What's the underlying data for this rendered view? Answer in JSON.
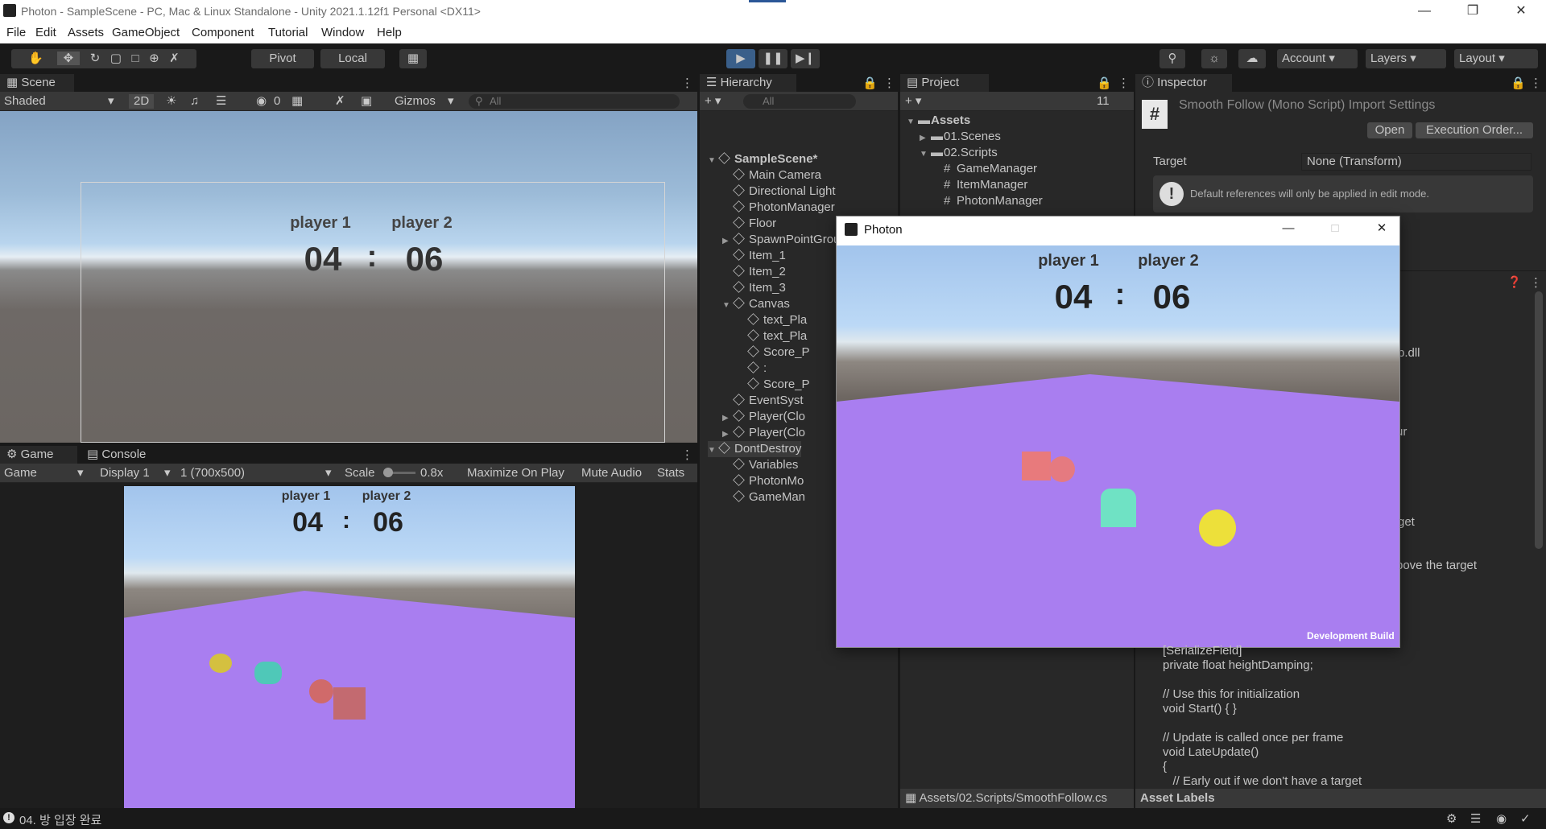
{
  "window": {
    "title": "Photon - SampleScene - PC, Mac & Linux Standalone - Unity 2021.1.12f1 Personal <DX11>"
  },
  "menu": [
    "File",
    "Edit",
    "Assets",
    "GameObject",
    "Component",
    "Tutorial",
    "Window",
    "Help"
  ],
  "toolbar": {
    "pivot": "Pivot",
    "local": "Local",
    "account": "Account",
    "layers": "Layers",
    "layout": "Layout"
  },
  "scene": {
    "tab": "Scene",
    "shading": "Shaded",
    "mode2d": "2D",
    "hidden_count": "0",
    "gizmos": "Gizmos",
    "search": "All"
  },
  "game": {
    "tab_game": "Game",
    "tab_console": "Console",
    "view": "Game",
    "display": "Display 1",
    "resolution": "1 (700x500)",
    "scale_label": "Scale",
    "scale_value": "0.8x",
    "maximize": "Maximize On Play",
    "mute": "Mute Audio",
    "stats": "Stats"
  },
  "score": {
    "p1": "player 1",
    "p2": "player 2",
    "s1": "04",
    "sep": ":",
    "s2": "06"
  },
  "hierarchy": {
    "tab": "Hierarchy",
    "search": "All",
    "items": [
      {
        "label": "SampleScene*"
      },
      {
        "label": "Main Camera"
      },
      {
        "label": "Directional Light"
      },
      {
        "label": "PhotonManager"
      },
      {
        "label": "Floor"
      },
      {
        "label": "SpawnPointGroup"
      },
      {
        "label": "Item_1"
      },
      {
        "label": "Item_2"
      },
      {
        "label": "Item_3"
      },
      {
        "label": "Canvas"
      },
      {
        "label": "text_Pla"
      },
      {
        "label": "text_Pla"
      },
      {
        "label": "Score_P"
      },
      {
        "label": ":"
      },
      {
        "label": "Score_P"
      },
      {
        "label": "EventSyst"
      },
      {
        "label": "Player(Clo"
      },
      {
        "label": "Player(Clo"
      },
      {
        "label": "DontDestroy"
      },
      {
        "label": "Variables"
      },
      {
        "label": "PhotonMo"
      },
      {
        "label": "GameMan"
      }
    ]
  },
  "project": {
    "tab": "Project",
    "hidden_count": "11",
    "items": [
      {
        "label": "Assets"
      },
      {
        "label": "01.Scenes"
      },
      {
        "label": "02.Scripts"
      },
      {
        "label": "GameManager"
      },
      {
        "label": "ItemManager"
      },
      {
        "label": "PhotonManager"
      }
    ],
    "path": "Assets/02.Scripts/SmoothFollow.cs"
  },
  "inspector": {
    "tab": "Inspector",
    "title": "Smooth Follow (Mono Script) Import Settings",
    "open": "Open",
    "exec_order": "Execution Order...",
    "target_label": "Target",
    "target_value": "None (Transform)",
    "info": "Default references will only be applied in edit mode.",
    "frag_dll": "p.dll",
    "frag_ur": "ur",
    "frag_get": "get",
    "frag_above": "bove the target",
    "asset_labels": "Asset Labels",
    "code": [
      "[SerializeField]",
      "private float heightDamping;",
      "",
      "// Use this for initialization",
      "void Start() { }",
      "",
      "// Update is called once per frame",
      "void LateUpdate()",
      "{",
      "   // Early out if we don't have a target"
    ]
  },
  "popup": {
    "title": "Photon",
    "dev_build": "Development Build"
  },
  "status": {
    "message": "04. 방 입장 완료"
  },
  "colors": {
    "accent": "#2b5797",
    "floor": "#a880f0",
    "sky": "#a9c9ea"
  }
}
